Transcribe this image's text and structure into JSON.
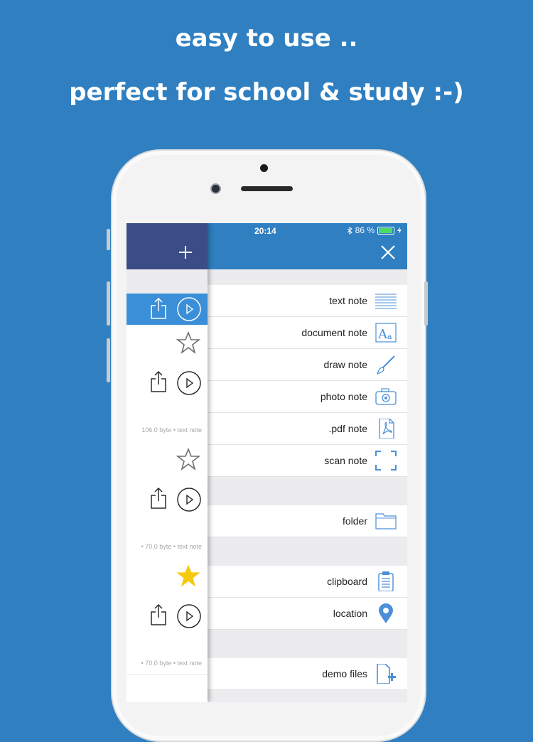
{
  "headline": {
    "line1": "easy to use ..",
    "line2": "perfect for school & study :-)"
  },
  "status_bar": {
    "signal": "●●○○○",
    "time": "20:14",
    "bluetooth_icon": "bluetooth-icon",
    "battery_percent": "86 %",
    "battery_level": 0.86,
    "battery_color": "#4cd964"
  },
  "colors": {
    "background": "#2f7fc1",
    "drawer_header": "#3b4d86",
    "selected_row": "#3b8fd8",
    "icon_blue": "#4a8fd8",
    "star_gold": "#f6c90e"
  },
  "menu": {
    "items": [
      {
        "label": "text note",
        "icon": "text-lines-icon"
      },
      {
        "label": "document note",
        "icon": "font-aa-icon"
      },
      {
        "label": "draw note",
        "icon": "brush-icon"
      },
      {
        "label": "photo note",
        "icon": "camera-icon"
      },
      {
        "label": ".pdf note",
        "icon": "pdf-icon"
      },
      {
        "label": "scan note",
        "icon": "scan-frame-icon"
      },
      {
        "label": "folder",
        "icon": "folder-icon"
      },
      {
        "label": "clipboard",
        "icon": "clipboard-icon"
      },
      {
        "label": "location",
        "icon": "location-pin-icon"
      },
      {
        "label": "demo files",
        "icon": "add-file-icon"
      }
    ]
  },
  "drawer": {
    "entries": [
      {
        "info": "106.0 byte • text note",
        "starred": false
      },
      {
        "info": "• 70.0 byte • text note",
        "starred": false
      },
      {
        "info": "• 70.0 byte • text note",
        "starred": true
      }
    ]
  }
}
